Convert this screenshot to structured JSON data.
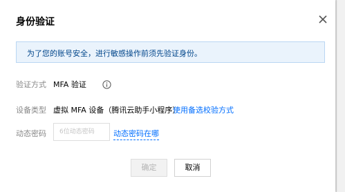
{
  "dialog": {
    "title": "身份验证",
    "close_icon": "close-icon",
    "notice": "为了您的账号安全，进行敏感操作前须先验证身份。",
    "rows": {
      "method": {
        "label": "验证方式",
        "value": "MFA 验证",
        "icon": "info-icon"
      },
      "device": {
        "label": "设备类型",
        "value": "虚拟 MFA 设备（腾讯云助手小程序）",
        "link": "使用备选校验方式"
      },
      "code": {
        "label": "动态密码",
        "placeholder": "6位动态密码",
        "link": "动态密码在哪"
      }
    },
    "buttons": {
      "confirm": "确定",
      "cancel": "取消"
    }
  },
  "colors": {
    "link": "#006eff",
    "notice_bg": "#eaf3fc",
    "notice_border": "#b9d6f3",
    "notice_text": "#00458a"
  }
}
